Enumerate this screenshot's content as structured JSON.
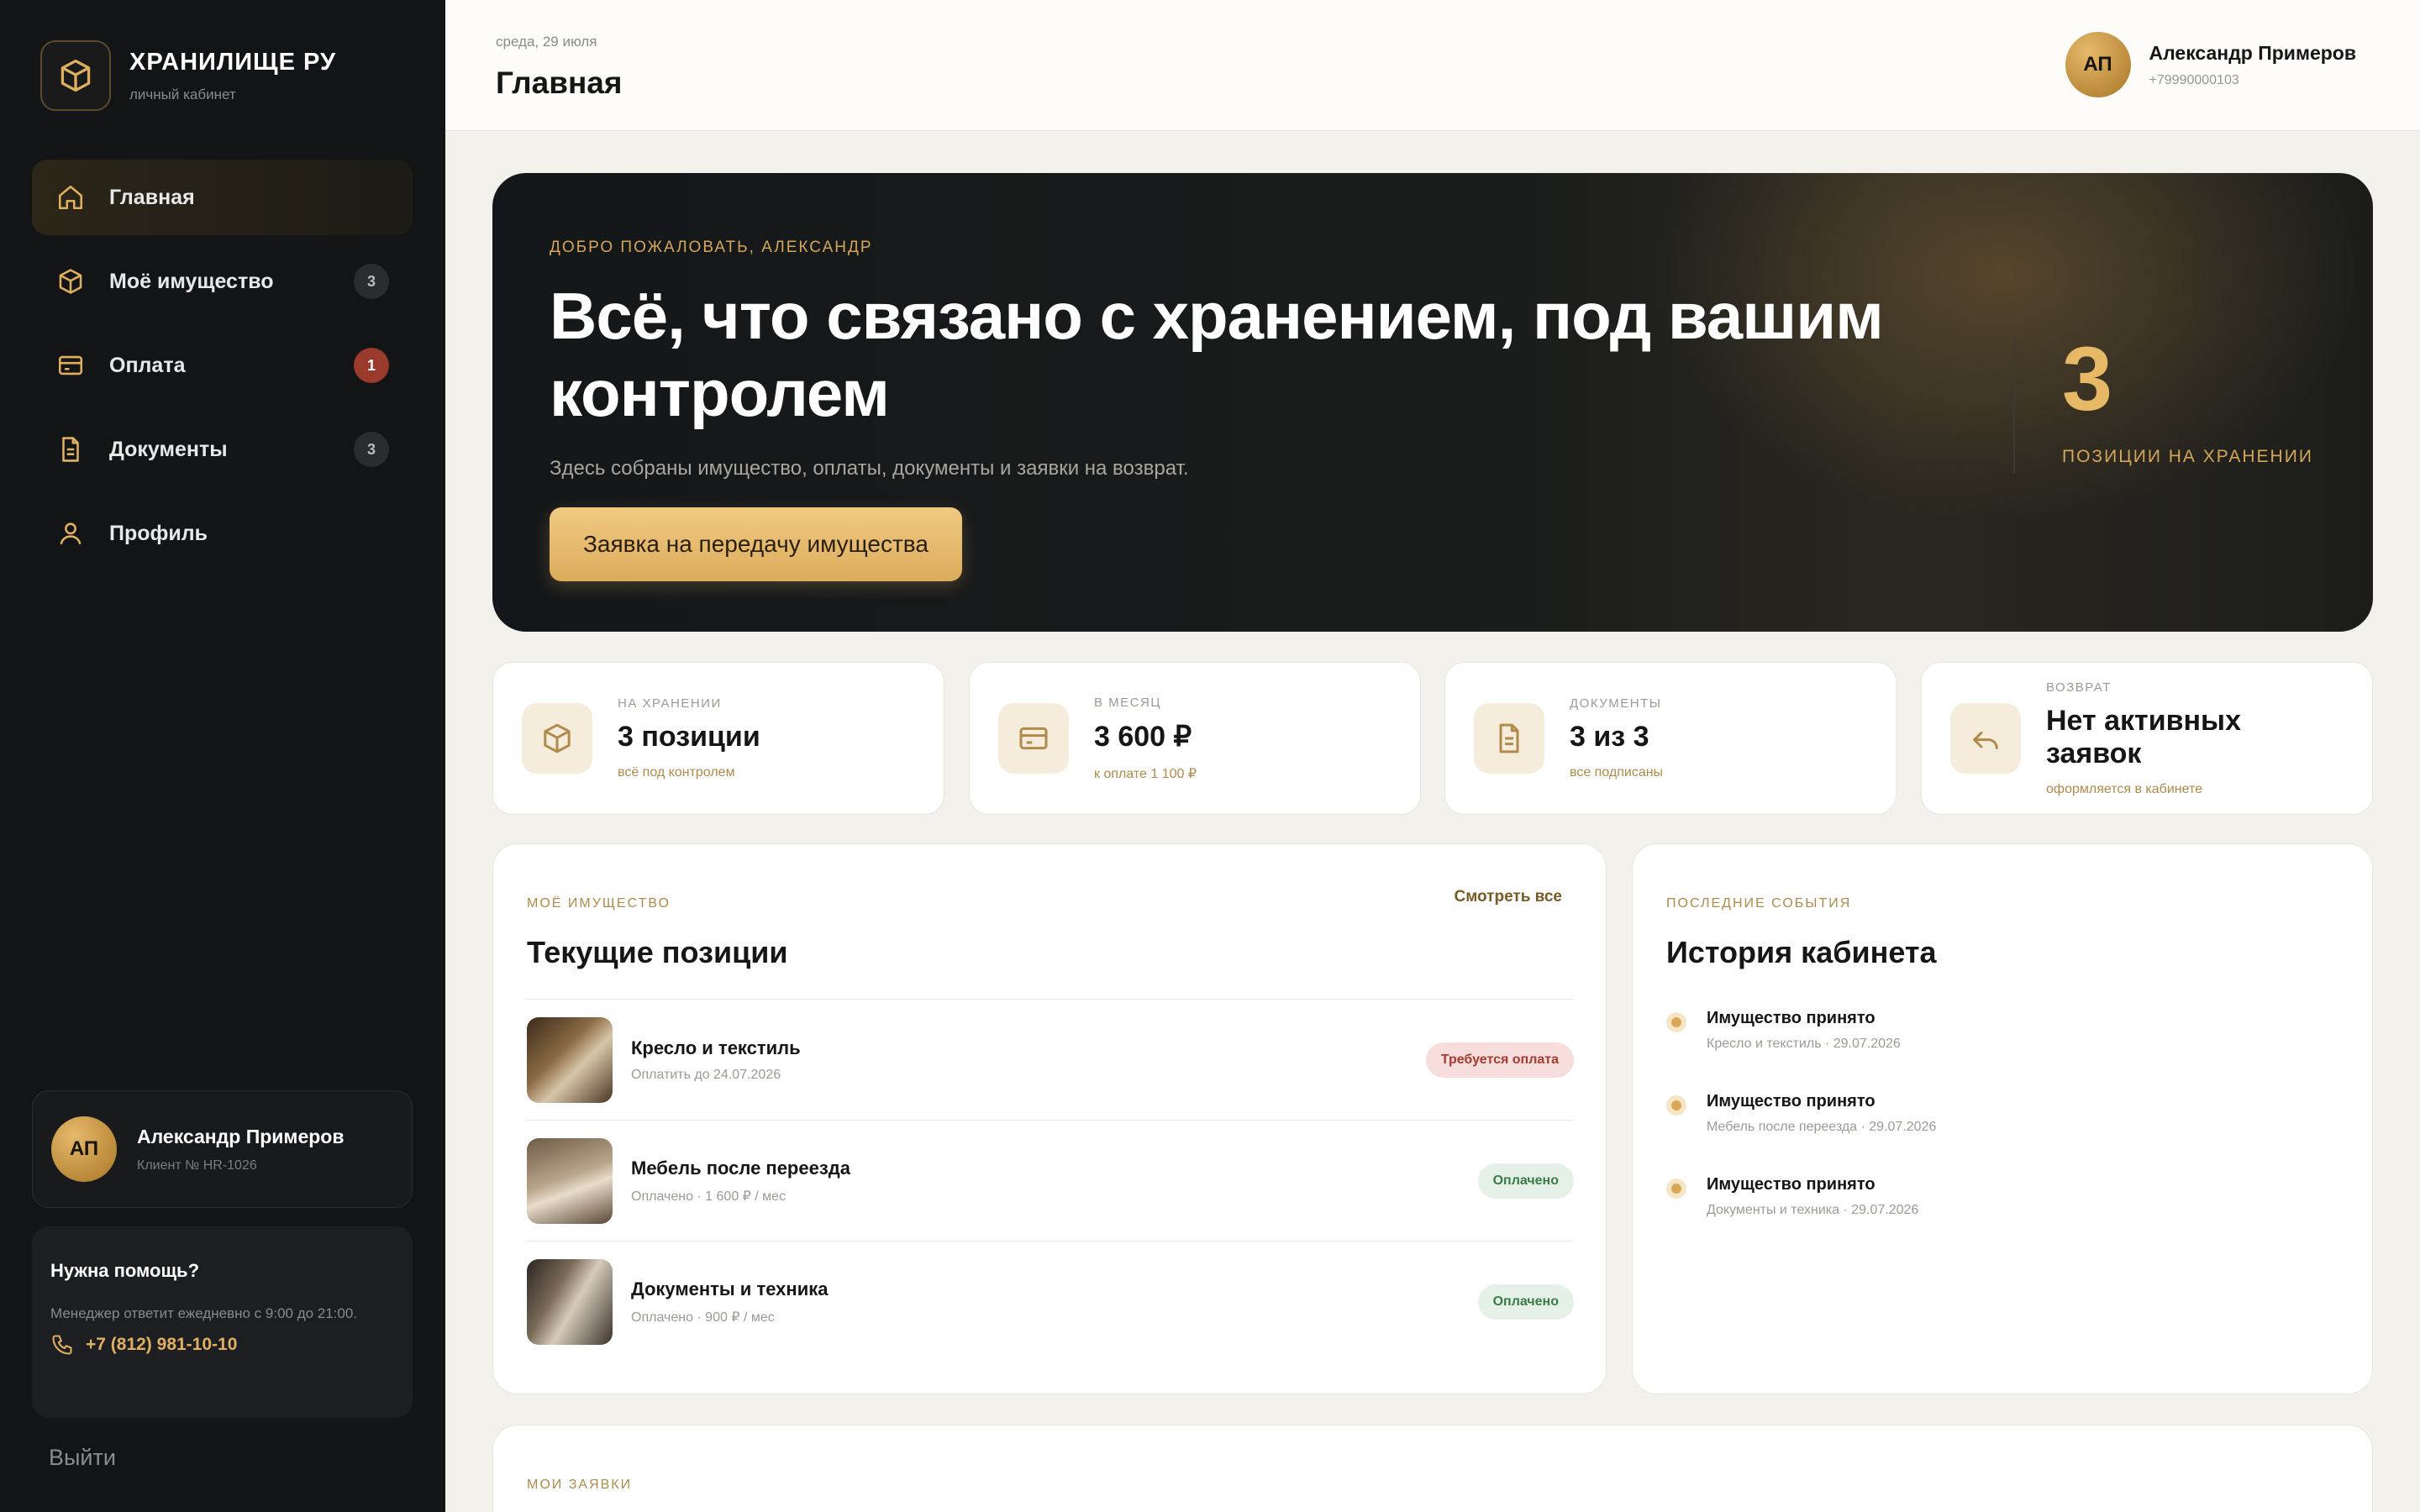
{
  "brand": {
    "title": "ХРАНИЛИЩЕ РУ",
    "subtitle": "личный кабинет"
  },
  "nav": [
    {
      "label": "Главная",
      "icon": "home-icon",
      "active": true,
      "badge": ""
    },
    {
      "label": "Моё имущество",
      "icon": "box-icon",
      "badge": "3"
    },
    {
      "label": "Оплата",
      "icon": "card-icon",
      "badge": "1"
    },
    {
      "label": "Документы",
      "icon": "document-icon",
      "badge": "3"
    },
    {
      "label": "Профиль",
      "icon": "user-icon",
      "badge": ""
    }
  ],
  "user": {
    "initials": "АП",
    "name": "Александр Примеров",
    "client_id": "Клиент № HR-1026",
    "phone": "+79990000103"
  },
  "help": {
    "title": "Нужна помощь?",
    "text": "Менеджер ответит ежедневно с 9:00 до 21:00.",
    "phone": "+7 (812) 981-10-10"
  },
  "logout": "Выйти",
  "header": {
    "date": "среда, 29 июля",
    "title": "Главная"
  },
  "hero": {
    "kicker": "ДОБРО ПОЖАЛОВАТЬ, АЛЕКСАНДР",
    "title": "Всё, что связано с хранением, под вашим контролем",
    "subtitle": "Здесь собраны имущество, оплаты, документы и заявки на возврат.",
    "button": "Заявка на передачу имущества",
    "count": "3",
    "count_label": "ПОЗИЦИИ НА ХРАНЕНИИ"
  },
  "stats": [
    {
      "kicker": "НА ХРАНЕНИИ",
      "value": "3 позиции",
      "sub": "всё под контролем",
      "icon": "box-icon"
    },
    {
      "kicker": "В МЕСЯЦ",
      "value": "3 600 ₽",
      "sub": "к оплате 1 100 ₽",
      "icon": "card-icon"
    },
    {
      "kicker": "ДОКУМЕНТЫ",
      "value": "3 из 3",
      "sub": "все подписаны",
      "icon": "document-icon"
    },
    {
      "kicker": "ВОЗВРАТ",
      "value": "Нет активных заявок",
      "sub": "оформляется в кабинете",
      "icon": "return-arrow-icon"
    }
  ],
  "items_panel": {
    "kicker": "МОЁ ИМУЩЕСТВО",
    "title": "Текущие позиции",
    "link": "Смотреть все",
    "items": [
      {
        "name": "Кресло и текстиль",
        "meta": "Оплатить до 24.07.2026",
        "status": "Требуется оплата",
        "status_type": "due"
      },
      {
        "name": "Мебель после переезда",
        "meta": "Оплачено · 1 600 ₽ / мес",
        "status": "Оплачено",
        "status_type": "paid"
      },
      {
        "name": "Документы и техника",
        "meta": "Оплачено · 900 ₽ / мес",
        "status": "Оплачено",
        "status_type": "paid"
      }
    ]
  },
  "events_panel": {
    "kicker": "ПОСЛЕДНИЕ СОБЫТИЯ",
    "title": "История кабинета",
    "events": [
      {
        "title": "Имущество принято",
        "meta": "Кресло и текстиль · 29.07.2026"
      },
      {
        "title": "Имущество принято",
        "meta": "Мебель после переезда · 29.07.2026"
      },
      {
        "title": "Имущество принято",
        "meta": "Документы и техника · 29.07.2026"
      }
    ]
  },
  "requests_panel": {
    "kicker": "МОИ ЗАЯВКИ"
  },
  "colors": {
    "accent": "#dcac5c",
    "sidebar": "#121416",
    "background": "#f3f1ec",
    "due": "#a83a2e",
    "paid": "#3a7b48"
  }
}
